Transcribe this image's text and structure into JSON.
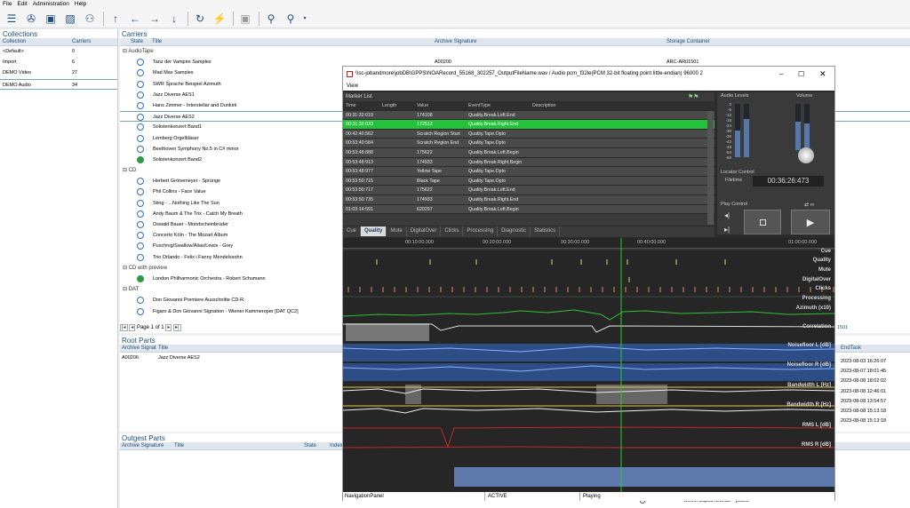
{
  "menu": [
    "File",
    "Edit",
    "Administration",
    "Help"
  ],
  "collections": {
    "title": "Collections",
    "headers": [
      "Collection",
      "Carriers"
    ],
    "rows": [
      [
        "<Default>",
        "0"
      ],
      [
        "Import",
        "6"
      ],
      [
        "DEMO Video",
        "27"
      ],
      [
        "DEMO Audio",
        "34"
      ]
    ]
  },
  "carriers": {
    "title": "Carriers",
    "headers": [
      "State",
      "Title",
      "Archive Signature",
      "Storage Container"
    ],
    "groups": [
      {
        "name": "AudioTape",
        "items": [
          [
            "Tanz der Vampire Samples",
            "A00200",
            "ARC-AR01501"
          ],
          [
            "Mad Max Samples",
            "",
            ""
          ],
          [
            "SWR Sprache Beispiel Azimuth",
            "",
            ""
          ],
          [
            "Jazz Diverse AES1",
            "",
            ""
          ],
          [
            "Hans Zimmer - Interstellar and Dunkirk",
            "",
            ""
          ],
          [
            "Jazz Diverse AES2",
            "",
            ""
          ],
          [
            "Solistenkonzert Band1",
            "",
            ""
          ],
          [
            "Lemberg Orgelbläser",
            "",
            ""
          ],
          [
            "Beethoven Symphony No.5 in C# minor",
            "",
            ""
          ],
          [
            "Solistenkonzert Band2",
            "",
            ""
          ]
        ]
      },
      {
        "name": "CD",
        "items": [
          [
            "Herbert Grönemeyer - Sprünge",
            "",
            ""
          ],
          [
            "Phil Collins - Face Value",
            "",
            ""
          ],
          [
            "Sting - ...Nothing Like The Sun",
            "",
            ""
          ],
          [
            "Andy Baum & The Trix - Catch My Breath",
            "",
            ""
          ],
          [
            "Oswald Bauer - Mondscheinbrüder",
            "",
            ""
          ],
          [
            "Concerto Köln - The Mozart Album",
            "",
            ""
          ],
          [
            "Puschnig/Swallow/Alias/Lewis - Grey",
            "",
            ""
          ],
          [
            "Trio Orlando - Felix i Fanny Mendelssohn",
            "",
            ""
          ]
        ]
      },
      {
        "name": "CD with preview",
        "items": [
          [
            "London Philharmonic Orchestra - Robert Schumann",
            "",
            ""
          ]
        ]
      },
      {
        "name": "DAT",
        "items": [
          [
            "Don Giovanni Premiere Ausschnitte CD-R",
            "",
            ""
          ],
          [
            "Figaro & Don Giovanni Signation - Wiener Kammeroper [DAT QC2]",
            "",
            ""
          ]
        ]
      }
    ],
    "pager": "Page 1 of 1",
    "right_fragment": "1501"
  },
  "root_parts": {
    "title": "Root Parts",
    "headers": [
      "Archive Signat",
      "Title"
    ],
    "row": [
      "A00206",
      "Jazz Diverse AES2"
    ],
    "endtask_header": "EndTask",
    "endtasks": [
      "2023-08-03 16:26:07",
      "2023-08-07 18:01:45",
      "2023-08-08 18:02:02",
      "2023-08-08 12:46:01",
      "2023-08-08 13:54:57",
      "2023-08-08 15:13:18",
      "2023-08-08 15:13:18"
    ]
  },
  "outgest_parts": {
    "title": "Outgest Parts",
    "headers": [
      "Archive Signature",
      "Title",
      "State",
      "Index"
    ]
  },
  "bottom_fragment": "Select CaptureBundle - jobDB",
  "window": {
    "title": "\\\\sc-jobandmore\\jobDB\\GPPS\\NOARecord_55168_302257_OutputFileName.wav / Audio pcm_f32le(PCM 32-bit floating point little-endian) 96000 2",
    "menu": "View",
    "marker_list": {
      "title": "Marker List",
      "headers": [
        "Time",
        "Length",
        "Value",
        "EventType",
        "Description"
      ],
      "rows": [
        [
          "00:31:32:019",
          "",
          "174108",
          "Quality.Break.Left.End"
        ],
        [
          "00:31:32:033",
          "",
          "172512",
          "Quality.Break.Right.End"
        ],
        [
          "00:42:40:562",
          "",
          "Scratch Region Start",
          "Quality.Tape.Opto"
        ],
        [
          "00:53:40:584",
          "",
          "Scratch Region End",
          "Quality.Tape.Opto"
        ],
        [
          "00:53:48:888",
          "",
          "175622",
          "Quality.Break.Left.Begin"
        ],
        [
          "00:53:48:913",
          "",
          "174933",
          "Quality.Break.Right.Begin"
        ],
        [
          "00:53:48:977",
          "",
          "Yellow Tape",
          "Quality.Tape.Opto"
        ],
        [
          "00:53:50:715",
          "",
          "Black Tape",
          "Quality.Tape.Opto"
        ],
        [
          "00:53:50:717",
          "",
          "175622",
          "Quality.Break.Left.End"
        ],
        [
          "00:53:50:735",
          "",
          "174933",
          "Quality.Break.Right.End"
        ],
        [
          "01:03:14:591",
          "",
          "620297",
          "Quality.Break.Left.Begin"
        ]
      ]
    },
    "audio_levels": "Audio Levels",
    "volume": "Volume",
    "level_ticks": [
      "0",
      "-6",
      "-12",
      "-18",
      "-24",
      "-30",
      "-36",
      "-42",
      "-48",
      "-54",
      "-60"
    ],
    "locator_control": "Locator Control",
    "filetime_label": "Filetime",
    "filetime": "00:36:26:473",
    "play_control": "Play Control",
    "tabs": [
      "Cue",
      "Quality",
      "Mute",
      "DigitalOver",
      "Clicks",
      "Processing",
      "Diagnostic",
      "Statistics"
    ],
    "timeline_ticks": [
      "00:10:00.000",
      "00:20:00.000",
      "00:30:00.000",
      "00:40:00.000",
      "01:00:00.000"
    ],
    "lanes": [
      "Cue",
      "Quality",
      "Mute",
      "DigitalOver",
      "Clicks",
      "Processing",
      "Azimuth (x10)",
      "Correlation",
      "Noisefloor L [dB]",
      "Noisefloor R [dB]",
      "Bandwidth L [Hz]",
      "Bandwidth R [Hz]",
      "RMS L [dB]",
      "RMS R [dB]"
    ],
    "status": [
      "NavigationPanel",
      "ACTIVE",
      "Playing"
    ]
  }
}
